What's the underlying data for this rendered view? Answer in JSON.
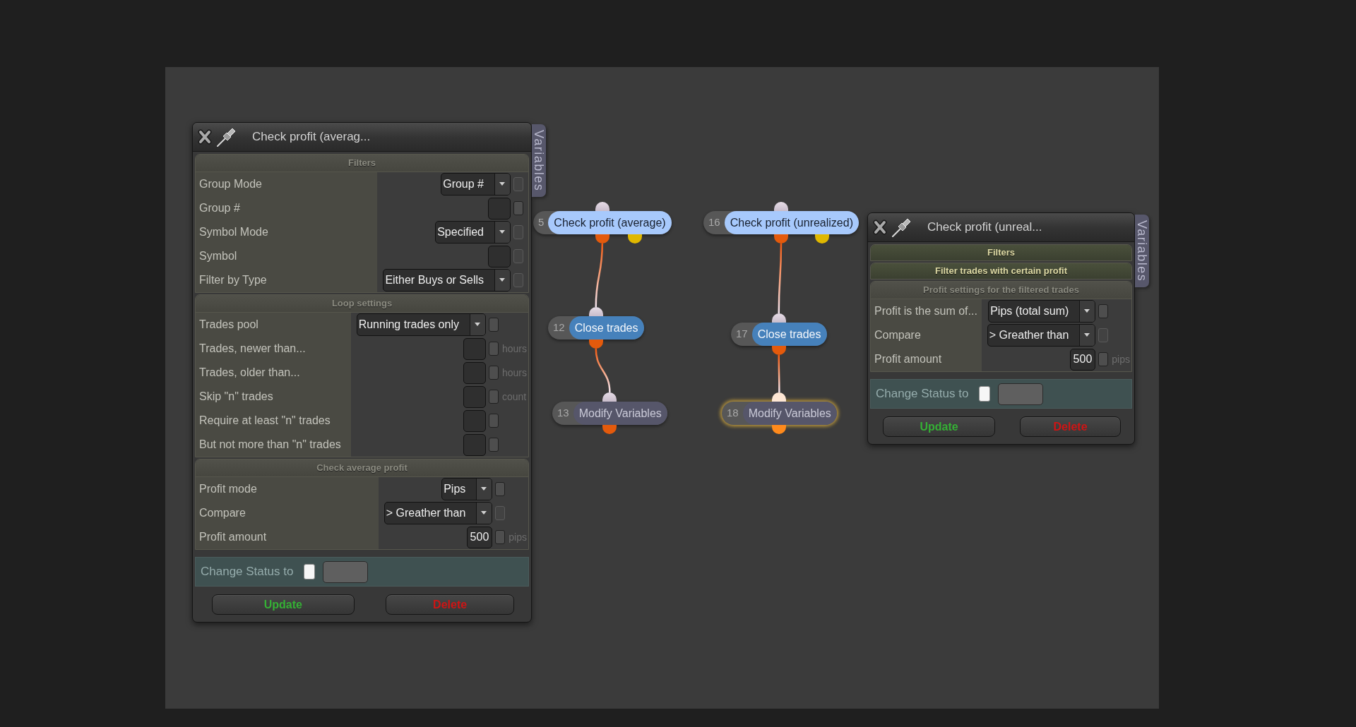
{
  "panels": [
    {
      "title": "Check profit (averag...",
      "side_tab": "Variables",
      "sections": [
        {
          "title": "Filters",
          "expanded": true,
          "rows": [
            {
              "label": "Group Mode",
              "kind": "dropdown",
              "value": "Group #",
              "checkbox": {
                "checked": false,
                "disabled": true
              }
            },
            {
              "label": "Group #",
              "kind": "input",
              "checkbox": {
                "checked": false,
                "disabled": false
              }
            },
            {
              "label": "Symbol Mode",
              "kind": "dropdown",
              "value": "Specified",
              "checkbox": {
                "checked": false,
                "disabled": true
              }
            },
            {
              "label": "Symbol",
              "kind": "input",
              "checkbox": {
                "checked": false,
                "disabled": true
              }
            },
            {
              "label": "Filter by Type",
              "kind": "dropdown",
              "value": "Either Buys or Sells",
              "checkbox": {
                "checked": false,
                "disabled": true
              }
            }
          ]
        },
        {
          "title": "Loop settings",
          "expanded": true,
          "rows": [
            {
              "label": "Trades pool",
              "kind": "dropdown",
              "value": "Running trades only",
              "checkbox": {
                "checked": false,
                "disabled": false
              }
            },
            {
              "label": "Trades, newer than...",
              "kind": "input",
              "checkbox": {
                "checked": false,
                "disabled": false
              },
              "unit": "hours"
            },
            {
              "label": "Trades, older than...",
              "kind": "input",
              "checkbox": {
                "checked": false,
                "disabled": false
              },
              "unit": "hours"
            },
            {
              "label": "Skip \"n\" trades",
              "kind": "input",
              "checkbox": {
                "checked": false,
                "disabled": false
              },
              "unit": "count"
            },
            {
              "label": "Require at least \"n\" trades",
              "kind": "input",
              "checkbox": {
                "checked": false,
                "disabled": false
              }
            },
            {
              "label": "But not more than \"n\" trades",
              "kind": "input",
              "checkbox": {
                "checked": false,
                "disabled": false
              }
            }
          ]
        },
        {
          "title": "Check average profit",
          "expanded": true,
          "rows": [
            {
              "label": "Profit mode",
              "kind": "dropdown",
              "value": "Pips",
              "checkbox": {
                "checked": false,
                "disabled": false
              }
            },
            {
              "label": "Compare",
              "kind": "dropdown",
              "value": "> Greather than",
              "checkbox": {
                "checked": false,
                "disabled": true
              }
            },
            {
              "label": "Profit amount",
              "kind": "input",
              "value": "500",
              "checkbox": {
                "checked": false,
                "disabled": false
              },
              "unit": "pips"
            }
          ]
        }
      ],
      "status": {
        "label": "Change Status to",
        "checked": false
      },
      "buttons": [
        {
          "label": "Update",
          "kind": "update"
        },
        {
          "label": "Delete",
          "kind": "delete"
        }
      ]
    },
    {
      "title": "Check profit (unreal...",
      "side_tab": "Variables",
      "sections": [
        {
          "title": "Filters",
          "expanded": false
        },
        {
          "title": "Filter trades with certain profit",
          "expanded": false
        },
        {
          "title": "Profit settings for the filtered trades",
          "expanded": true,
          "rows": [
            {
              "label": "Profit is the sum of...",
              "kind": "dropdown",
              "value": "Pips (total sum)",
              "checkbox": {
                "checked": false,
                "disabled": false
              }
            },
            {
              "label": "Compare",
              "kind": "dropdown",
              "value": "> Greather than",
              "checkbox": {
                "checked": false,
                "disabled": true
              }
            },
            {
              "label": "Profit amount",
              "kind": "input",
              "value": "500",
              "checkbox": {
                "checked": false,
                "disabled": false
              },
              "unit": "pips"
            }
          ]
        }
      ],
      "status": {
        "label": "Change Status to",
        "checked": false
      },
      "buttons": [
        {
          "label": "Update",
          "kind": "update"
        },
        {
          "label": "Delete",
          "kind": "delete"
        }
      ]
    }
  ],
  "flows": [
    {
      "number": "5",
      "label": "Check profit (average)",
      "kind": "condition",
      "selected": false,
      "children": [
        {
          "number": "12",
          "label": "Close trades",
          "kind": "action",
          "selected": false,
          "children": [
            {
              "number": "13",
              "label": "Modify Variables",
              "kind": "variables",
              "selected": false
            }
          ]
        }
      ]
    },
    {
      "number": "16",
      "label": "Check profit (unrealized)",
      "kind": "condition",
      "selected": false,
      "children": [
        {
          "number": "17",
          "label": "Close trades",
          "kind": "action",
          "selected": false,
          "children": [
            {
              "number": "18",
              "label": "Modify Variables",
              "kind": "variables",
              "selected": true
            }
          ]
        }
      ]
    }
  ]
}
